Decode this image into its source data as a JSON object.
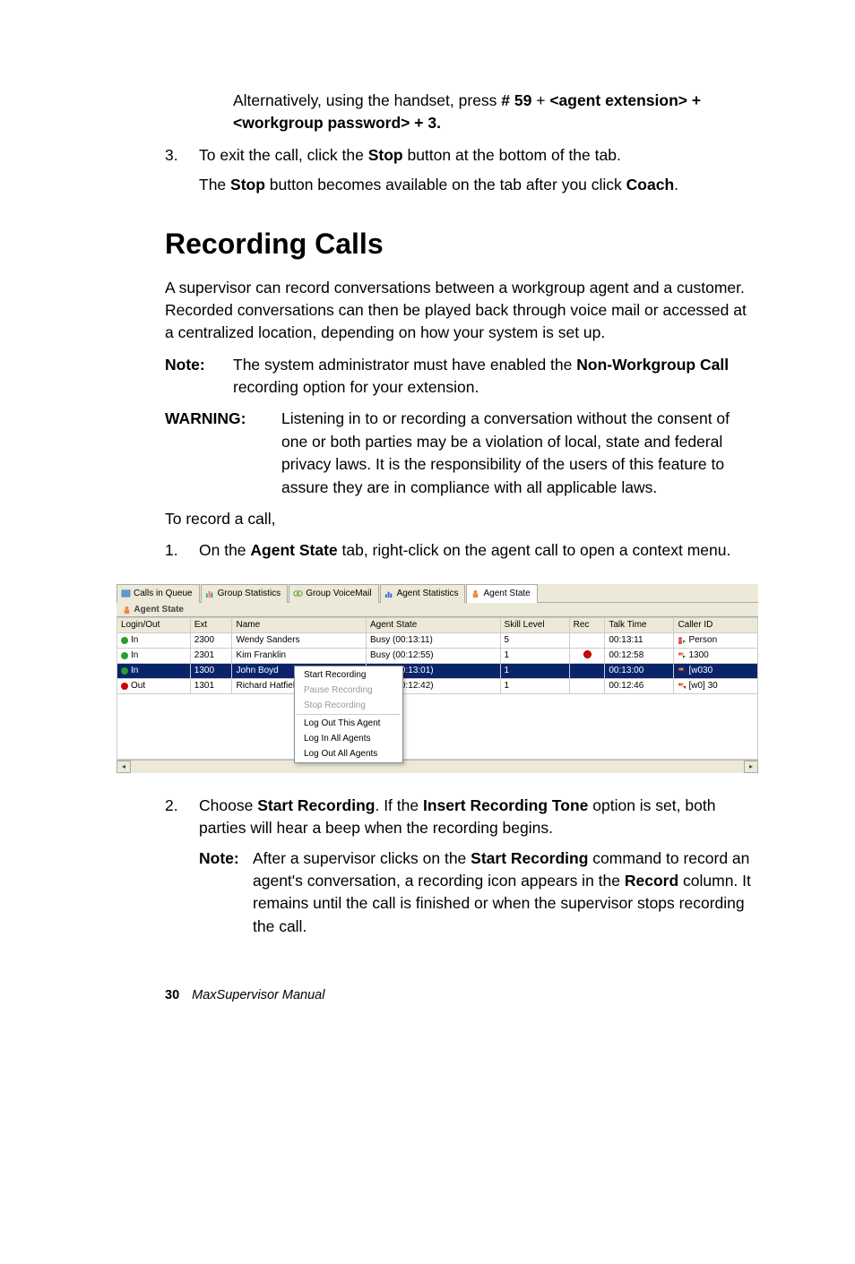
{
  "intro": {
    "alt_line": "Alternatively, using the handset, press ",
    "alt_code": "# 59",
    "alt_plus": " + ",
    "alt_agent": "<agent extension> + <workgroup password> + 3."
  },
  "step3": {
    "num": "3.",
    "text_a": "To exit the call, click the ",
    "stop": "Stop",
    "text_b": " button at the bottom of the tab.",
    "sub_a": "The ",
    "sub_b": " button becomes available on the tab after you click ",
    "coach": "Coach",
    "period": "."
  },
  "heading": "Recording Calls",
  "para1": "A supervisor can record conversations between a workgroup agent and a customer. Recorded conversations can then be played back through voice mail or accessed at a centralized location, depending on how your system is set up.",
  "note1": {
    "label": "Note:",
    "a": "The system administrator must have enabled the ",
    "b": "Non-Workgroup Call",
    "c": " recording option for your extension."
  },
  "warn": {
    "label": "WARNING:",
    "text": "Listening in to or recording a conversation without the consent of one or both parties may be a violation of local, state and federal privacy laws. It is the responsibility of the users of this feature to assure they are in compliance with all applicable laws."
  },
  "torecord": "To record a call,",
  "step1": {
    "num": "1.",
    "a": "On the ",
    "b": "Agent State",
    "c": " tab, right-click on the agent call to open a context menu."
  },
  "tabs": {
    "t1": "Calls in Queue",
    "t2": "Group Statistics",
    "t3": "Group VoiceMail",
    "t4": "Agent Statistics",
    "t5": "Agent State"
  },
  "subhead": "Agent State",
  "cols": {
    "c1": "Login/Out",
    "c2": "Ext",
    "c3": "Name",
    "c4": "Agent State",
    "c5": "Skill Level",
    "c6": "Rec",
    "c7": "Talk Time",
    "c8": "Caller ID"
  },
  "rows": [
    {
      "login": "In",
      "login_color": "green",
      "ext": "2300",
      "name": "Wendy Sanders",
      "state": "Busy (00:13:11)",
      "skill": "5",
      "rec": "",
      "talk": "00:13:11",
      "cid": "Person"
    },
    {
      "login": "In",
      "login_color": "green",
      "ext": "2301",
      "name": "Kim Franklin",
      "state": "Busy (00:12:55)",
      "skill": "1",
      "rec": "dot",
      "talk": "00:12:58",
      "cid": "1300"
    },
    {
      "login": "In",
      "login_color": "green",
      "ext": "1300",
      "name": "John Boyd",
      "state": "Busy (00:13:01)",
      "skill": "1",
      "rec": "",
      "talk": "00:13:00",
      "cid": "[w030"
    },
    {
      "login": "Out",
      "login_color": "red",
      "ext": "1301",
      "name": "Richard Hatfiel",
      "state": "Busy (00:12:42)",
      "skill": "1",
      "rec": "",
      "talk": "00:12:46",
      "cid": "[w0] 30"
    }
  ],
  "chart_data": {
    "type": "table",
    "columns": [
      "Login/Out",
      "Ext",
      "Name",
      "Agent State",
      "Skill Level",
      "Rec",
      "Talk Time",
      "Caller ID"
    ],
    "rows": [
      [
        "In",
        "2300",
        "Wendy Sanders",
        "Busy (00:13:11)",
        5,
        "",
        "00:13:11",
        "Person"
      ],
      [
        "In",
        "2301",
        "Kim Franklin",
        "Busy (00:12:55)",
        1,
        "recording",
        "00:12:58",
        "1300"
      ],
      [
        "In",
        "1300",
        "John Boyd",
        "Busy (00:13:01)",
        1,
        "",
        "00:13:00",
        "[w030"
      ],
      [
        "Out",
        "1301",
        "Richard Hatfiel",
        "Busy (00:12:42)",
        1,
        "",
        "00:12:46",
        "[w0] 30"
      ]
    ],
    "selected_row_index": 2,
    "title": "Agent State"
  },
  "menu": {
    "m1": "Start Recording",
    "m2": "Pause Recording",
    "m3": "Stop Recording",
    "m4": "Log Out This Agent",
    "m5": "Log In All Agents",
    "m6": "Log Out All Agents"
  },
  "step2": {
    "num": "2.",
    "a": "Choose ",
    "b": "Start Recording",
    "c": ". If the ",
    "d": "Insert Recording Tone",
    "e": " option is set, both parties will hear a beep when the recording begins."
  },
  "innernote": {
    "label": "Note:",
    "a": "After a supervisor clicks on the ",
    "b": "Start Recording",
    "c": " command to record an agent's conversation, a recording icon appears in the ",
    "d": "Record",
    "e": " column. It remains until the call is finished or when the supervisor stops recording the call."
  },
  "footer": {
    "page": "30",
    "title": "MaxSupervisor Manual"
  }
}
